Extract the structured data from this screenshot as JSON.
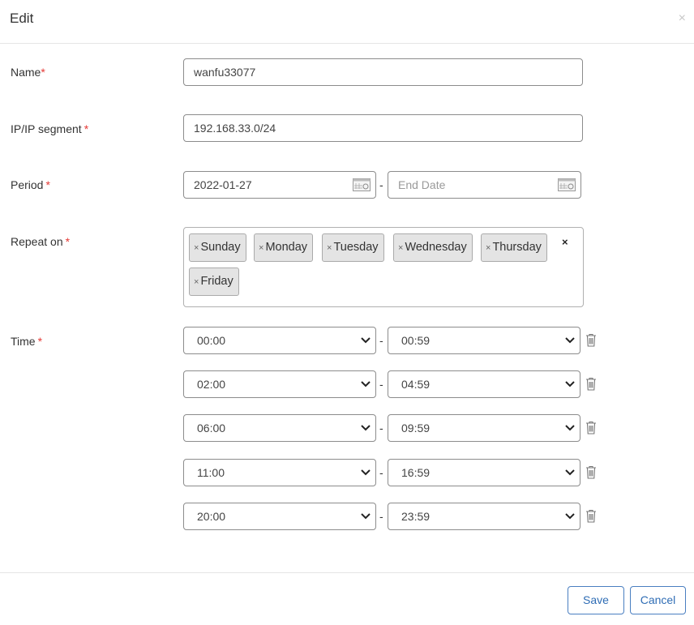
{
  "dialog": {
    "title": "Edit",
    "close_label": "×"
  },
  "form": {
    "name": {
      "label": "Name",
      "required_mark": "*",
      "value": "wanfu33077"
    },
    "ip": {
      "label": "IP/IP segment",
      "required_mark": "*",
      "value": "192.168.33.0/24"
    },
    "period": {
      "label": "Period",
      "required_mark": "*",
      "start_value": "2022-01-27",
      "end_value": "",
      "end_placeholder": "End Date",
      "separator": "-"
    },
    "repeat": {
      "label": "Repeat on",
      "required_mark": "*",
      "remove_mark": "×",
      "clear_all": "×",
      "days": [
        "Sunday",
        "Monday",
        "Tuesday",
        "Wednesday",
        "Thursday",
        "Friday"
      ]
    },
    "time": {
      "label": "Time",
      "required_mark": "*",
      "separator": "-",
      "rows": [
        {
          "start": "00:00",
          "end": "00:59"
        },
        {
          "start": "02:00",
          "end": "04:59"
        },
        {
          "start": "06:00",
          "end": "09:59"
        },
        {
          "start": "11:00",
          "end": "16:59"
        },
        {
          "start": "20:00",
          "end": "23:59"
        }
      ]
    }
  },
  "footer": {
    "save_label": "Save",
    "cancel_label": "Cancel"
  },
  "colors": {
    "required": "#e53935",
    "button_text": "#2f6db5",
    "button_border": "#4a7fc1"
  }
}
